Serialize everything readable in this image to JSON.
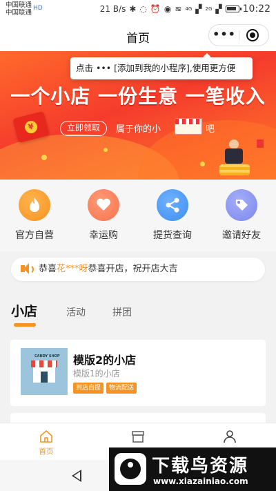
{
  "status_bar": {
    "carrier_1": "中国联通",
    "carrier_2": "中国联通",
    "hd": "HD",
    "speed": "21 B/s",
    "time": "10:22",
    "network_1": "4G",
    "network_2": "2G"
  },
  "nav": {
    "title": "首页",
    "more_icon": "•••"
  },
  "tooltip": {
    "text": "点击 ••• [添加到我的小程序],使用更方便"
  },
  "banner": {
    "headline": "一个小店 一份生意 一笔收入",
    "claim_button": "立即领取",
    "subtitle": "属于你的小",
    "subtitle_suffix": "吧",
    "envelope_symbol": "¥"
  },
  "menu": {
    "items": [
      {
        "label": "官方自营",
        "icon": "flame-icon",
        "color": "#f79322"
      },
      {
        "label": "幸运购",
        "icon": "heart-icon",
        "color": "#f6734e"
      },
      {
        "label": "提货查询",
        "icon": "share-icon",
        "color": "#3c8ff0"
      },
      {
        "label": "邀请好友",
        "icon": "tag-icon",
        "color": "#7b87ee"
      }
    ]
  },
  "notice": {
    "prefix": "恭喜",
    "highlight": "花***呀",
    "suffix": "恭喜开店，祝开店大吉"
  },
  "tabs": {
    "items": [
      "小店",
      "活动",
      "拼团"
    ],
    "active": "小店"
  },
  "shop": {
    "name": "模版2的小店",
    "desc": "模版1的小店",
    "tags": [
      "到店自提",
      "物流配送"
    ],
    "sign": "CANDY SHOP"
  },
  "tabbar": {
    "items": [
      {
        "label": "首页",
        "icon": "home-icon",
        "active": true
      },
      {
        "label": "",
        "icon": "store-icon",
        "active": false
      },
      {
        "label": "",
        "icon": "user-icon",
        "active": false
      }
    ]
  },
  "watermark": {
    "title": "下载鸟资源",
    "url": "www.xiazainiao.com"
  },
  "colors": {
    "accent": "#f79322",
    "banner": "#f53c2c"
  }
}
